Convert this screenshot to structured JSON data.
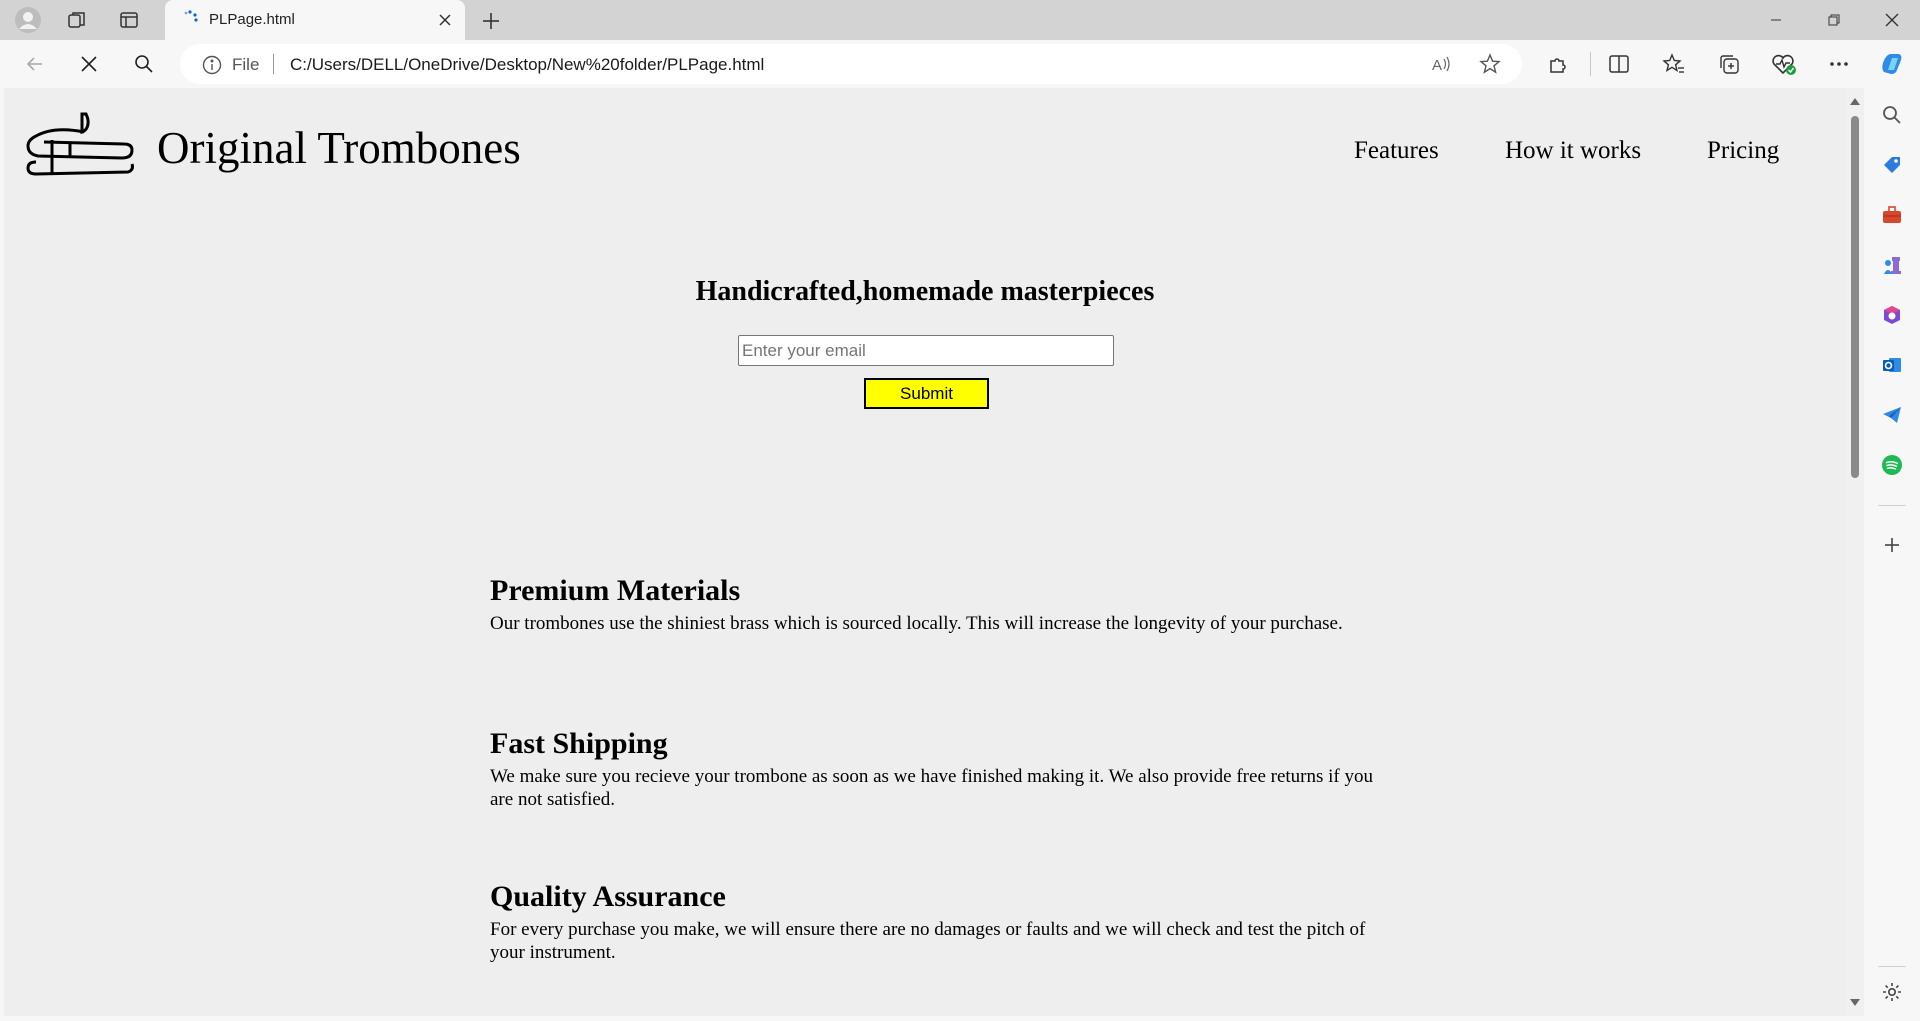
{
  "browser": {
    "tab_title": "PLPage.html",
    "address_label": "File",
    "url": "C:/Users/DELL/OneDrive/Desktop/New%20folder/PLPage.html"
  },
  "header": {
    "brand": "Original Trombones",
    "nav": [
      "Features",
      "How it works",
      "Pricing"
    ]
  },
  "hero": {
    "title": "Handicrafted,homemade masterpieces",
    "email_placeholder": "Enter your email",
    "submit_label": "Submit"
  },
  "features": [
    {
      "title": "Premium Materials",
      "text": "Our trombones use the shiniest brass which is sourced locally. This will increase the longevity of your purchase."
    },
    {
      "title": "Fast Shipping",
      "text": "We make sure you recieve your trombone as soon as we have finished making it. We also provide free returns if you are not satisfied."
    },
    {
      "title": "Quality Assurance",
      "text": "For every purchase you make, we will ensure there are no damages or faults and we will check and test the pitch of your instrument."
    }
  ],
  "colors": {
    "submit_bg": "#ffff00",
    "page_bg": "#eeeeee"
  }
}
